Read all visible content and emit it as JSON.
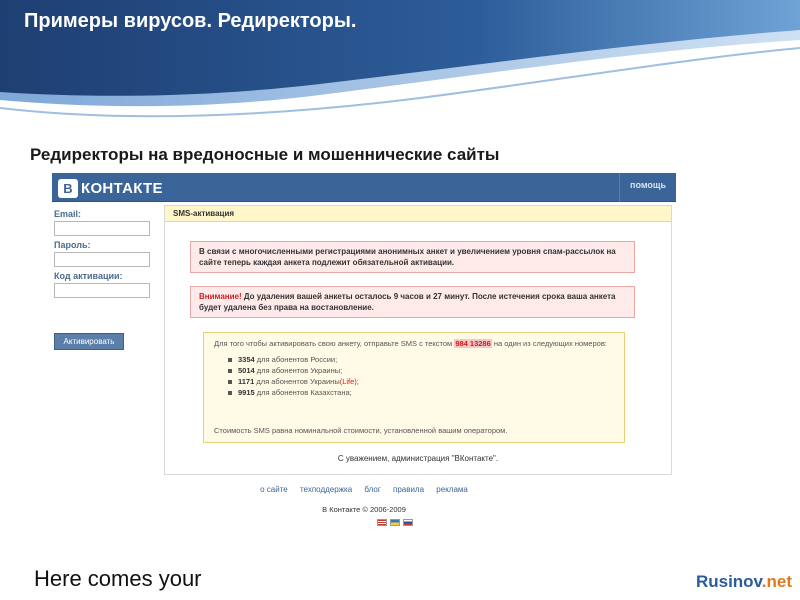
{
  "slide": {
    "title": "Примеры вирусов. Редиректоры.",
    "subtitle": "Редиректоры на вредоносные и мошеннические сайты",
    "bottom_text": "Here comes your",
    "brand_name": "Rusinov",
    "brand_suffix": ".net",
    "colors": {
      "header_dark": "#1e3f72",
      "header_light": "#4b84c2",
      "brand": "#2b5b9a",
      "brand_accent": "#e07a1e"
    }
  },
  "vk": {
    "logo_badge": "B",
    "logo_text": "КОНТАКТЕ",
    "help": "помощь",
    "sidebar": {
      "email_label": "Email:",
      "password_label": "Пароль:",
      "code_label": "Код активации:",
      "activate_button": "Активировать"
    },
    "panel": {
      "title": "SMS-активация",
      "notice1": "В связи с многочисленными регистрациями анонимных анкет и увеличением уровня спам-рассылок на сайте теперь каждая анкета подлежит обязательной активации.",
      "notice2_attn": "Внимание!",
      "notice2_text": " До удаления вашей анкеты осталось 9 часов и 27 минут. После истечения срока ваша анкета будет удалена без права на востановление.",
      "sms_intro_before": "Для того чтобы активировать свою анкету, отправьте SMS с текстом ",
      "sms_code": "984 13286",
      "sms_intro_after": " на один из следующих номеров:",
      "numbers": [
        {
          "number": "3354",
          "text": " для абонентов России;",
          "extra": ""
        },
        {
          "number": "5014",
          "text": " для абонентов Украины;",
          "extra": ""
        },
        {
          "number": "1171",
          "text": " для абонентов Украины",
          "extra": "(Life);"
        },
        {
          "number": "9915",
          "text": " для абонентов Казахстана;",
          "extra": ""
        }
      ],
      "sms_footer": "Стоимость SMS равна номинальной стоимости, установленной вашим оператором.",
      "signature": "С уважением, администрация \"ВКонтакте\"."
    },
    "footer": {
      "links": [
        "о сайте",
        "техподдержка",
        "блог",
        "правила",
        "реклама"
      ],
      "copyright": "В Контакте © 2006-2009"
    }
  }
}
